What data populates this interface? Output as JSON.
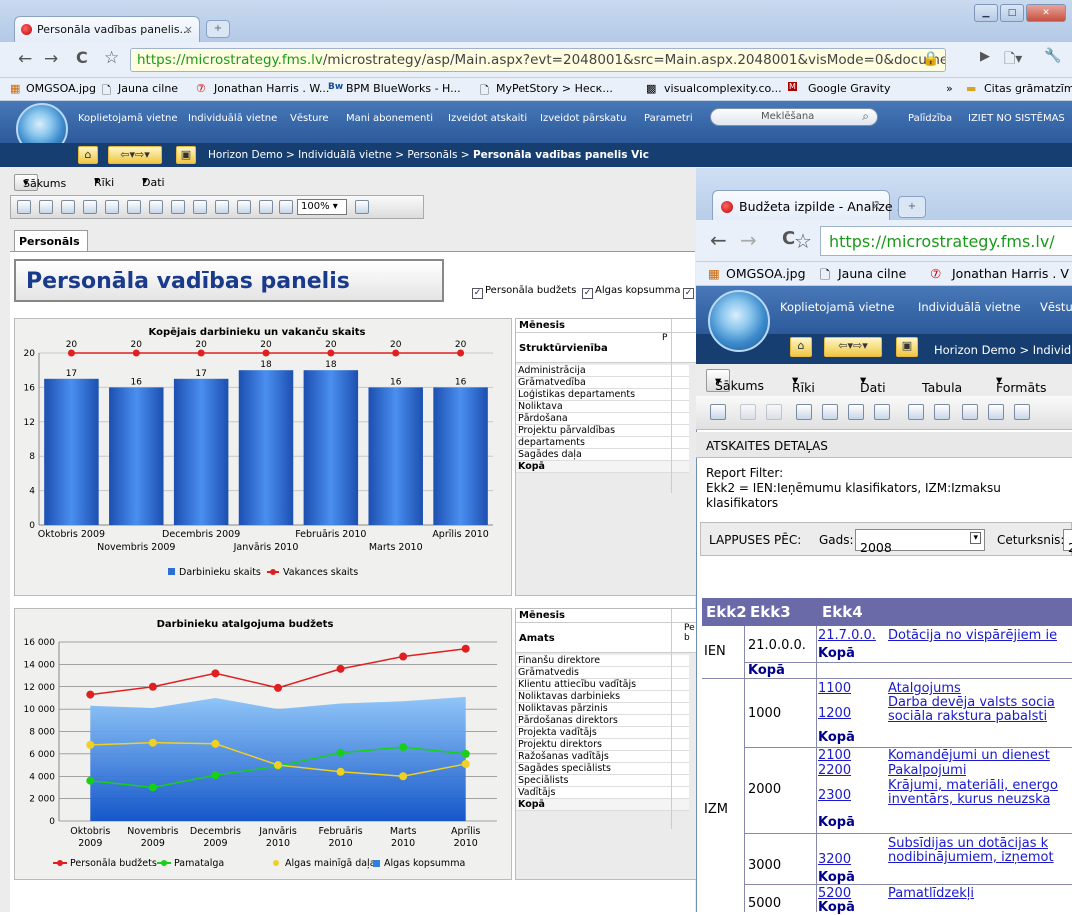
{
  "browser": {
    "tab_title": "Personāla vadības panelis...",
    "url_host": "https://microstrategy.fms.lv",
    "url_rest": "/microstrategy/asp/Main.aspx?evt=2048001&src=Main.aspx.2048001&visMode=0&documentID=F",
    "bookmarks": [
      "OMGSOA.jpg",
      "Jauna cilne",
      "Jonathan Harris . W...",
      "BPM BlueWorks - H...",
      "MyPetStory > Неск...",
      "visualcomplexity.co...",
      "Google Gravity",
      "»",
      "Citas grāmatzīmes"
    ]
  },
  "app": {
    "menu": [
      "Koplietojamā vietne",
      "Individuālā vietne",
      "Vēsture",
      "Mani abonementi",
      "Izveidot atskaiti",
      "Izveidot pārskatu",
      "Parametri"
    ],
    "search_placeholder": "Meklēšana",
    "help": "Palīdzība",
    "logout": "IZIET NO SISTĒMAS",
    "breadcrumb_prefix": "Horizon Demo > Individuālā vietne > Personāls > ",
    "breadcrumb_current": "Personāla vadības panelis Vic"
  },
  "doc": {
    "menus": [
      "Sākums",
      "Rīki",
      "Dati"
    ],
    "zoom": "100%",
    "page_tab": "Personāls",
    "title": "Personāla vadības panelis",
    "checkboxes": [
      "Personāla budžets",
      "Algas kopsumma"
    ]
  },
  "grid1": {
    "header1": "Mēnesis",
    "header2": "Struktūrvienība",
    "header_right": "P",
    "rows": [
      "Administrācija",
      "Grāmatvedība",
      "Loģistikas departaments",
      "Noliktava",
      "Pārdošana",
      "Projektu pārvaldības",
      "departaments",
      "Sagādes daļa"
    ],
    "total": "Kopā"
  },
  "grid2": {
    "header1": "Mēnesis",
    "header2": "Amats",
    "header_right": "Pe b",
    "rows": [
      "Finanšu direktore",
      "Grāmatvedis",
      "Klientu attiecību vadītājs",
      "Noliktavas darbinieks",
      "Noliktavas pārzinis",
      "Pārdošanas direktors",
      "Projekta vadītājs",
      "Projektu direktors",
      "Ražošanas vadītājs",
      "Sagādes speciālists",
      "Speciālists",
      "Vadītājs"
    ],
    "total": "Kopā"
  },
  "chart_data": [
    {
      "type": "bar",
      "title": "Kopējais darbinieku un vakanču skaits",
      "categories": [
        "Oktobris 2009",
        "Novembris 2009",
        "Decembris 2009",
        "Janvāris 2010",
        "Februāris 2010",
        "Marts 2010",
        "Aprīlis 2010"
      ],
      "series": [
        {
          "name": "Darbinieku skaits",
          "values": [
            17,
            16,
            17,
            18,
            18,
            16,
            16
          ],
          "color": "#2e6fd6"
        },
        {
          "name": "Vakances skaits",
          "values": [
            20,
            20,
            20,
            20,
            20,
            20,
            20
          ],
          "color": "#e02020"
        }
      ],
      "ylim": [
        0,
        20
      ],
      "yticks": [
        0,
        4,
        8,
        12,
        16,
        20
      ],
      "legend": "bottom"
    },
    {
      "type": "line",
      "title": "Darbinieku atalgojuma budžets",
      "categories": [
        "Oktobris 2009",
        "Novembris 2009",
        "Decembris 2009",
        "Janvāris 2010",
        "Februāris 2010",
        "Marts 2010",
        "Aprīlis 2010"
      ],
      "series": [
        {
          "name": "Personāla budžets",
          "values": [
            11300,
            12000,
            13200,
            11900,
            13600,
            14700,
            15400
          ],
          "color": "#e02020"
        },
        {
          "name": "Pamatalga",
          "values": [
            3600,
            3000,
            4100,
            4900,
            6100,
            6600,
            6000
          ],
          "color": "#18d018"
        },
        {
          "name": "Algas mainīgā daļa",
          "values": [
            6800,
            7000,
            6900,
            5000,
            4400,
            4000,
            5100
          ],
          "color": "#f0d020"
        },
        {
          "name": "Algas kopsumma",
          "values": [
            10300,
            10100,
            11000,
            10000,
            10500,
            10700,
            11100
          ],
          "color": "#2e7fe0"
        }
      ],
      "ylim": [
        0,
        16000
      ],
      "yticks": [
        "0",
        "2 000",
        "4 000",
        "6 000",
        "8 000",
        "10 000",
        "12 000",
        "14 000",
        "16 000"
      ],
      "legend": "bottom"
    }
  ],
  "win2": {
    "tab_title": "Budžeta izpilde - Analīze ...",
    "url": "https://microstrategy.fms.lv/",
    "bookmarks": [
      "OMGSOA.jpg",
      "Jauna cilne",
      "Jonathan Harris . V"
    ],
    "menu": [
      "Koplietojamā vietne",
      "Individuālā vietne",
      "Vēstu"
    ],
    "breadcrumb": "Horizon Demo > Individ",
    "doc_menus": [
      "Sākums",
      "Rīki",
      "Dati",
      "Tabula",
      "Formāts"
    ],
    "details_label": "ATSKAITES DETAĻAS",
    "filter_label": "Report Filter:",
    "filter_text": "Ekk2 = IEN:Ieņēmumu klasifikators, IZM:Izmaksu klasifikators",
    "page_by_label": "LAPPUSES PĒC:",
    "year_label": "Gads:",
    "year_value": "2008",
    "quarter_label": "Ceturksnis:",
    "quarter_value": "2",
    "columns": [
      "Ekk2",
      "Ekk3",
      "Ekk4"
    ],
    "kopa": "Kopā",
    "rows": {
      "ien": "IEN",
      "izm": "IZM",
      "c21": "21.0.0.0.",
      "c21a": "21.7.0.0.",
      "c21a_t": "Dotācija no vispārējiem ie",
      "g1000": "1000",
      "r1100": "1100",
      "r1100_t": "Atalgojums",
      "r1200": "1200",
      "r1200_t1": "Darba devēja valsts socia",
      "r1200_t2": "sociāla rakstura pabalsti",
      "g2000": "2000",
      "r2100": "2100",
      "r2100_t": "Komandējumi un dienest",
      "r2200": "2200",
      "r2200_t": "Pakalpojumi",
      "r2300": "2300",
      "r2300_t1": "Krājumi, materiāli, energo",
      "r2300_t2": "inventārs, kurus neuzska",
      "g3000": "3000",
      "r3200": "3200",
      "r3200_t1": "Subsīdijas un dotācijas k",
      "r3200_t2": "nodibinājumiem, izņemot",
      "g5000": "5000",
      "r5200": "5200",
      "r5200_t": "Pamatlīdzekļi"
    }
  }
}
